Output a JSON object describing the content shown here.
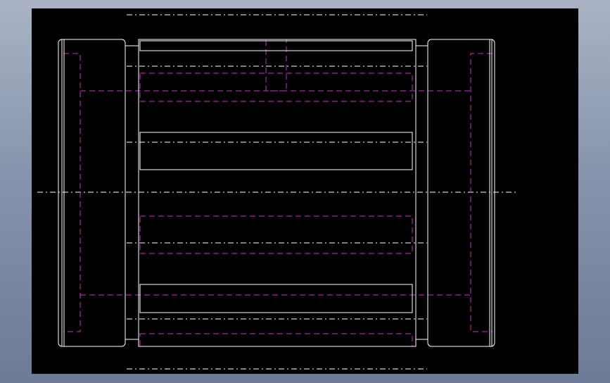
{
  "background": {
    "gradient_top": "#a9b3c4",
    "gradient_bottom": "#6c7a96"
  },
  "viewport": {
    "background": "#000000"
  },
  "colors": {
    "visible_edge": "#ffffff",
    "hidden_edge": "#c832c8",
    "center_line": "#ffffff"
  },
  "line_styles": {
    "visible_edge": "solid",
    "hidden_edge": "dashed",
    "center_line": "dash-dot"
  }
}
